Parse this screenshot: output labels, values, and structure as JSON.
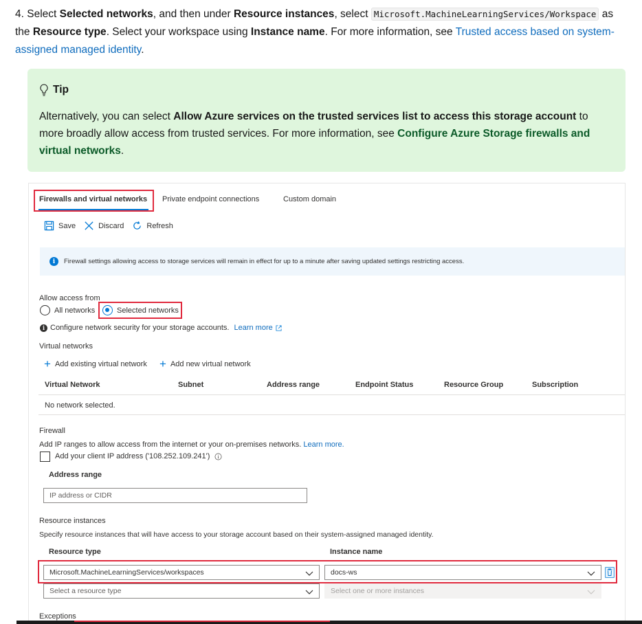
{
  "step": {
    "number": "4.",
    "t1": " Select ",
    "b1": "Selected networks",
    "t2": ", and then under ",
    "b2": "Resource instances",
    "t3": ", select ",
    "code": "Microsoft.MachineLearningServices/Workspace",
    "t4": " as the ",
    "b3": "Resource type",
    "t5": ". Select your workspace using ",
    "b4": "Instance name",
    "t6": ". For more information, see ",
    "link": "Trusted access based on system-assigned managed identity",
    "t7": "."
  },
  "tip": {
    "title": "Tip",
    "t1": "Alternatively, you can select ",
    "b1": "Allow Azure services on the trusted services list to access this storage account",
    "t2": " to more broadly allow access from trusted services. For more information, see ",
    "link": "Configure Azure Storage firewalls and virtual networks",
    "t3": "."
  },
  "panel": {
    "tabs": [
      "Firewalls and virtual networks",
      "Private endpoint connections",
      "Custom domain"
    ],
    "toolbar": {
      "save": "Save",
      "discard": "Discard",
      "refresh": "Refresh"
    },
    "banner": "Firewall settings allowing access to storage services will remain in effect for up to a minute after saving updated settings restricting access.",
    "allow_access_label": "Allow access from",
    "radio_all": "All networks",
    "radio_selected": "Selected networks",
    "configure_text": "Configure network security for your storage accounts.",
    "learn_more": "Learn more",
    "vnet_label": "Virtual networks",
    "add_existing": "Add existing virtual network",
    "add_new": "Add new virtual network",
    "columns": [
      "Virtual Network",
      "Subnet",
      "Address range",
      "Endpoint Status",
      "Resource Group",
      "Subscription"
    ],
    "no_network": "No network selected.",
    "firewall_label": "Firewall",
    "firewall_desc": "Add IP ranges to allow access from the internet or your on-premises networks.",
    "firewall_learn": "Learn more.",
    "client_ip": "Add your client IP address ('108.252.109.241')",
    "address_range_label": "Address range",
    "address_placeholder": "IP address or CIDR",
    "resource_instances_label": "Resource instances",
    "resource_instances_desc": "Specify resource instances that will have access to your storage account based on their system-assigned managed identity.",
    "resource_type_label": "Resource type",
    "instance_name_label": "Instance name",
    "resource_type_value": "Microsoft.MachineLearningServices/workspaces",
    "instance_name_value": "docs-ws",
    "resource_type_placeholder": "Select a resource type",
    "instance_placeholder": "Select one or more instances",
    "exceptions_label": "Exceptions"
  },
  "colors": {
    "accent": "#0078d4",
    "highlight": "#e0293d",
    "tip_bg": "#dff6dd",
    "link": "#0f6cbd"
  }
}
